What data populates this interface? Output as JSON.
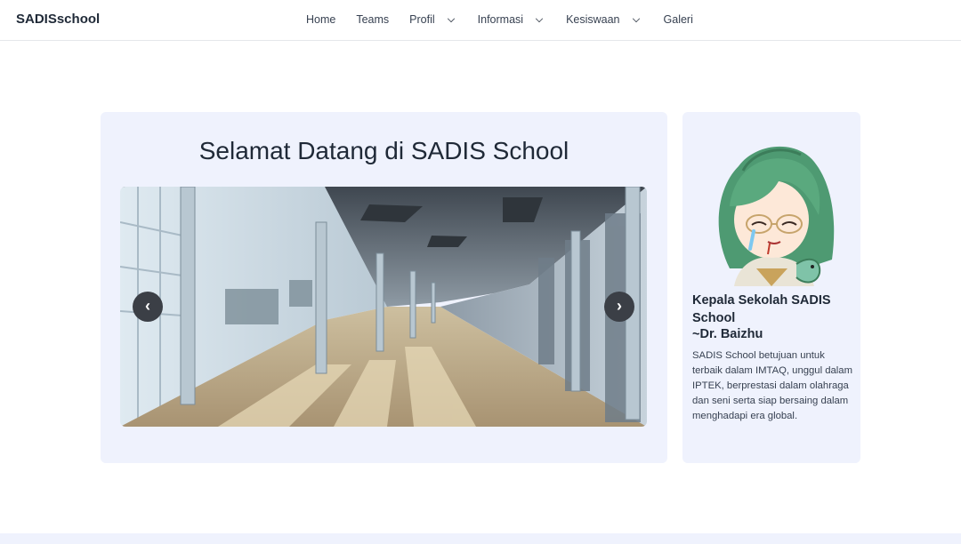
{
  "navbar": {
    "brand": "SADISschool",
    "items": [
      {
        "label": "Home"
      },
      {
        "label": "Teams"
      },
      {
        "label": "Profil"
      },
      {
        "label": "Informasi"
      },
      {
        "label": "Kesiswaan"
      },
      {
        "label": "Galeri"
      }
    ]
  },
  "hero": {
    "title": "Selamat Datang di SADIS School",
    "prev_label": "‹",
    "next_label": "›"
  },
  "principal": {
    "title": "Kepala Sekolah SADIS School",
    "name": "~Dr. Baizhu",
    "description": "SADIS School betujuan untuk terbaik dalam IMTAQ, unggul dalam IPTEK, berprestasi dalam olahraga dan seni serta siap bersaing dalam menghadapi era global."
  },
  "colors": {
    "card_bg": "#eff2fd",
    "carousel_button": "#3b3f46",
    "text": "#1f2937"
  }
}
